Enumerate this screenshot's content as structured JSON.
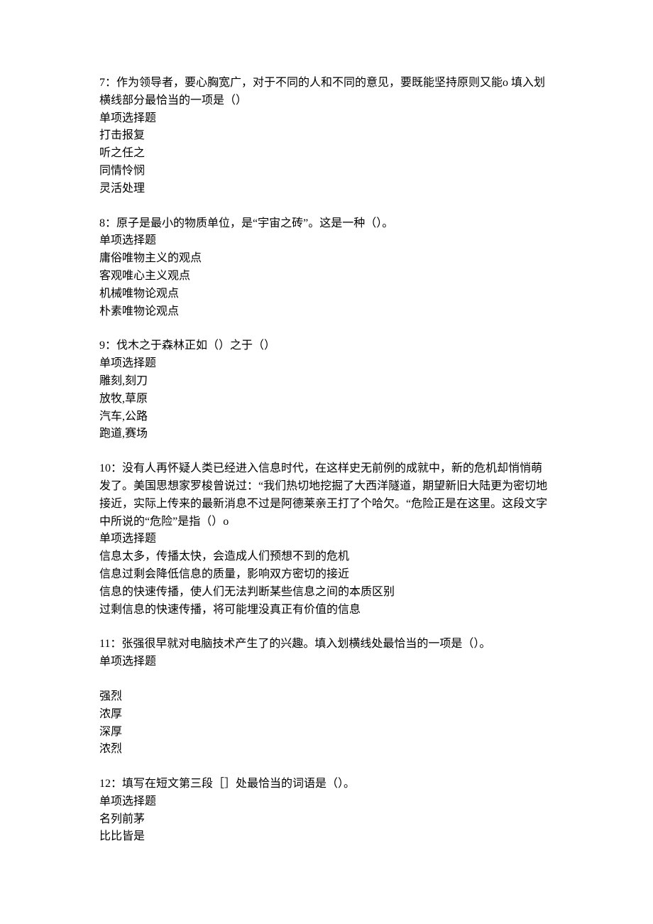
{
  "questions": [
    {
      "number": "7",
      "stem": "作为领导者，要心胸宽广，对于不同的人和不同的意见，要既能坚持原则又能o 填入划横线部分最恰当的一项是（）",
      "type_label": "单项选择题",
      "options": [
        "打击报复",
        "听之任之",
        "同情怜悯",
        "灵活处理"
      ]
    },
    {
      "number": "8",
      "stem": "原子是最小的物质单位，是“宇宙之砖”。这是一种（）。",
      "type_label": "单项选择题",
      "options": [
        "庸俗唯物主义的观点",
        "客观唯心主义观点",
        "机械唯物论观点",
        "朴素唯物论观点"
      ]
    },
    {
      "number": "9",
      "stem": "伐木之于森林正如（）之于（）",
      "type_label": "单项选择题",
      "options": [
        "雕刻,刻刀",
        "放牧,草原",
        "汽车,公路",
        "跑道,赛场"
      ]
    },
    {
      "number": "10",
      "stem": "没有人再怀疑人类已经进入信息时代，在这样史无前例的成就中，新的危机却悄悄萌发了。美国思想家罗梭曾说过：“我们热切地挖掘了大西洋隧道，期望新旧大陆更为密切地接近，实际上传来的最新消息不过是阿德莱亲王打了个哈欠。“危险正是在这里。这段文字中所说的“危险”是指（）o",
      "type_label": "单项选择题",
      "options": [
        "信息太多，传播太快，会造成人们预想不到的危机",
        "信息过剩会降低信息的质量，影响双方密切的接近",
        "信息的快速传播，使人们无法判断某些信息之间的本质区别",
        "过剩信息的快速传播，将可能埋没真正有价值的信息"
      ]
    },
    {
      "number": "11",
      "stem": "张强很早就对电脑技术产生了的兴趣。填入划横线处最恰当的一项是（）。",
      "type_label": "单项选择题",
      "blank_before_options": true,
      "options": [
        "强烈",
        "浓厚",
        "深厚",
        "浓烈"
      ]
    },
    {
      "number": "12",
      "stem": "填写在短文第三段［］处最恰当的词语是（）。",
      "type_label": "单项选择题",
      "options": [
        "名列前茅",
        "比比皆是"
      ]
    }
  ]
}
